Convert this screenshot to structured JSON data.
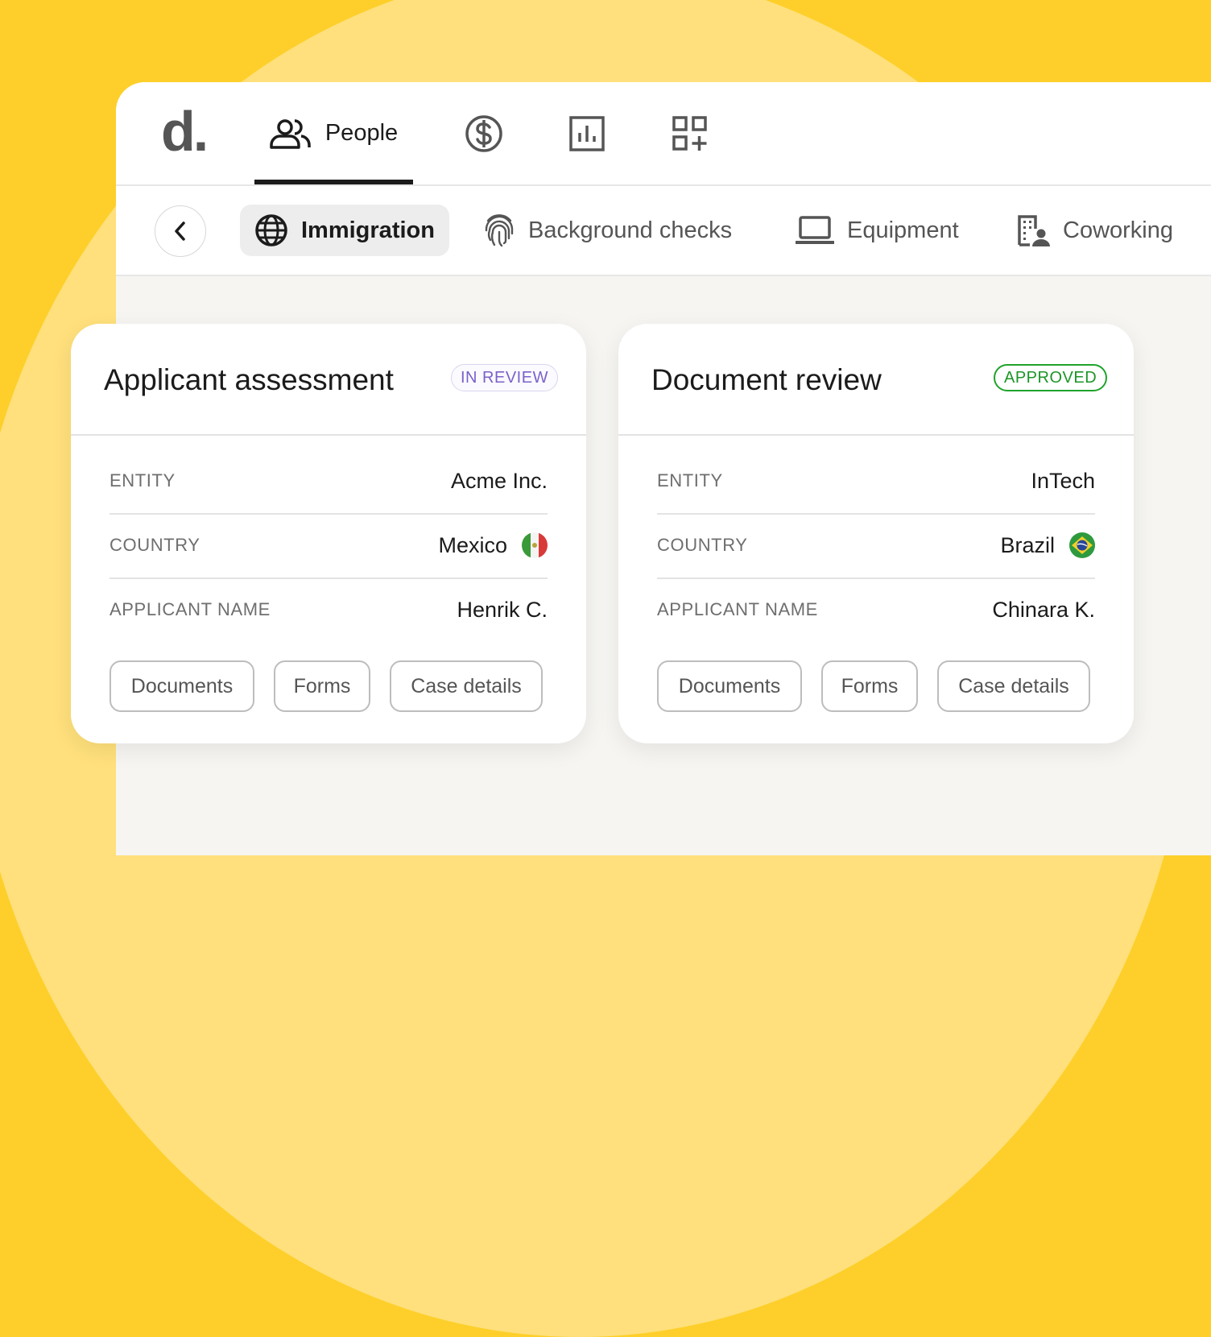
{
  "app": {
    "logo": "d."
  },
  "nav": {
    "tabs": [
      {
        "label": "People",
        "icon": "people-icon",
        "active": true
      },
      {
        "icon": "dollar-icon"
      },
      {
        "icon": "chart-icon"
      },
      {
        "icon": "apps-add-icon"
      }
    ]
  },
  "subnav": {
    "back_icon": "chevron-left-icon",
    "tabs": [
      {
        "label": "Immigration",
        "icon": "globe-icon",
        "active": true
      },
      {
        "label": "Background checks",
        "icon": "fingerprint-icon"
      },
      {
        "label": "Equipment",
        "icon": "laptop-icon"
      },
      {
        "label": "Coworking",
        "icon": "building-person-icon"
      }
    ]
  },
  "cards": [
    {
      "title": "Applicant assessment",
      "status": "IN REVIEW",
      "status_color": "#7B62C9",
      "rows": [
        {
          "label": "ENTITY",
          "value": "Acme Inc."
        },
        {
          "label": "COUNTRY",
          "value": "Mexico",
          "flag": "mexico-flag-icon"
        },
        {
          "label": "APPLICANT NAME",
          "value": "Henrik C."
        }
      ],
      "buttons": [
        "Documents",
        "Forms",
        "Case details"
      ]
    },
    {
      "title": "Document review",
      "status": "APPROVED",
      "status_color": "#1FA32B",
      "rows": [
        {
          "label": "ENTITY",
          "value": "InTech"
        },
        {
          "label": "COUNTRY",
          "value": "Brazil",
          "flag": "brazil-flag-icon"
        },
        {
          "label": "APPLICANT NAME",
          "value": "Chinara K."
        }
      ],
      "buttons": [
        "Documents",
        "Forms",
        "Case details"
      ]
    }
  ],
  "colors": {
    "background": "#FECF2A",
    "background_arc": "#FFE07C",
    "accent": "#1b1b1b"
  }
}
